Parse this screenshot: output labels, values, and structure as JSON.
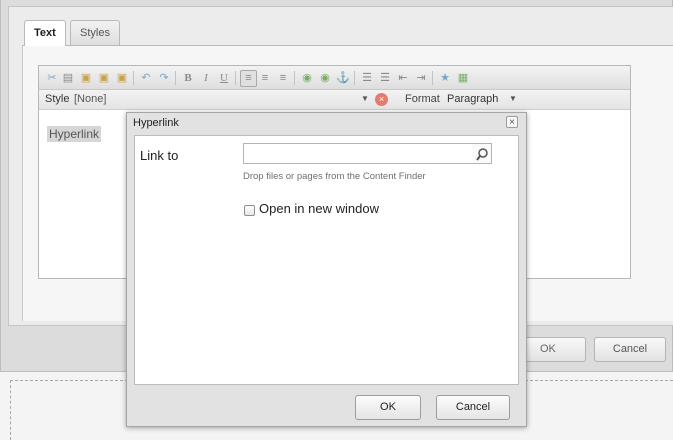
{
  "editor": {
    "tabs": [
      {
        "label": "Text"
      },
      {
        "label": "Styles"
      }
    ],
    "style_label": "Style",
    "style_value": "[None]",
    "format_label": "Format",
    "format_value": "Paragraph",
    "content_text": "Hyperlink",
    "toolbar_glyphs": {
      "bold": "B",
      "italic": "I",
      "underline": "U",
      "anchor": "⚓"
    },
    "ok_label": "OK",
    "cancel_label": "Cancel"
  },
  "hyperlink_dialog": {
    "title": "Hyperlink",
    "close_glyph": "×",
    "link_to_label": "Link to",
    "link_value": "",
    "hint": "Drop files or pages from the Content Finder",
    "new_window_label": "Open in new window",
    "new_window_checked": false,
    "ok_label": "OK",
    "cancel_label": "Cancel"
  },
  "colors": {
    "dialog_bg": "#e2e2e2",
    "panel_bg": "#ececec",
    "highlight": "#d6d6d6"
  },
  "icons": [
    "cut-icon",
    "copy-icon",
    "paste-icon",
    "paste-text-icon",
    "paste-word-icon",
    "undo-icon",
    "redo-icon",
    "bold-icon",
    "italic-icon",
    "underline-icon",
    "align-left-icon",
    "align-center-icon",
    "align-right-icon",
    "link-icon",
    "unlink-icon",
    "anchor-icon",
    "bullet-list-icon",
    "numbered-list-icon",
    "outdent-icon",
    "indent-icon",
    "special-char-icon",
    "table-icon",
    "search-icon",
    "close-icon"
  ]
}
